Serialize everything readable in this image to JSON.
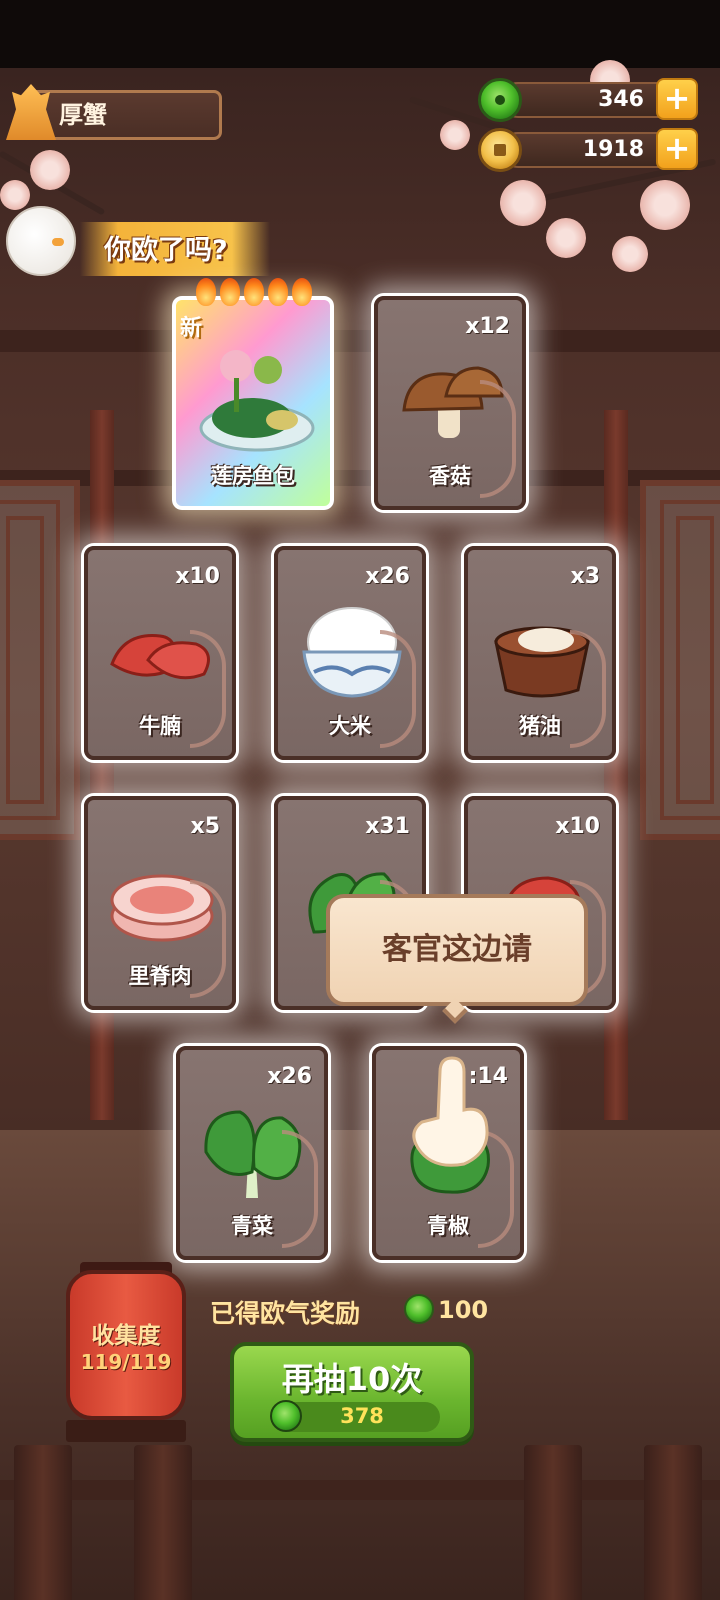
{
  "player": {
    "name": "厚蟹"
  },
  "currencies": {
    "jade": {
      "value": "346",
      "icon": "jade-icon"
    },
    "gold": {
      "value": "1918",
      "icon": "gold-coin-icon"
    }
  },
  "banner": {
    "text": "你欧了吗?"
  },
  "featured_card": {
    "label": "莲房鱼包",
    "badge": "新",
    "rarity_flames": 5
  },
  "cards": [
    {
      "label": "香菇",
      "count": "x12",
      "icon": "mushroom-icon"
    },
    {
      "label": "牛腩",
      "count": "x10",
      "icon": "beef-brisket-icon"
    },
    {
      "label": "大米",
      "count": "x26",
      "icon": "rice-bowl-icon"
    },
    {
      "label": "猪油",
      "count": "x3",
      "icon": "lard-icon"
    },
    {
      "label": "里脊肉",
      "count": "x5",
      "icon": "tenderloin-icon"
    },
    {
      "label": "",
      "count": "x31",
      "icon": "green-leaf-icon"
    },
    {
      "label": "",
      "count": "x10",
      "icon": "red-meat-icon"
    },
    {
      "label": "青菜",
      "count": "x26",
      "icon": "bok-choy-icon"
    },
    {
      "label": "青椒",
      "count": ":14",
      "icon": "green-pepper-icon"
    }
  ],
  "tooltip": {
    "text": "客官这边请"
  },
  "collection": {
    "title": "收集度",
    "progress": "119/119"
  },
  "reward": {
    "label": "已得欧气奖励",
    "value": "100"
  },
  "draw_button": {
    "label": "再抽10次",
    "cost": "378"
  },
  "colors": {
    "accent_green": "#6ab52e",
    "gold": "#f7c24a",
    "card_bg": "#877470"
  }
}
